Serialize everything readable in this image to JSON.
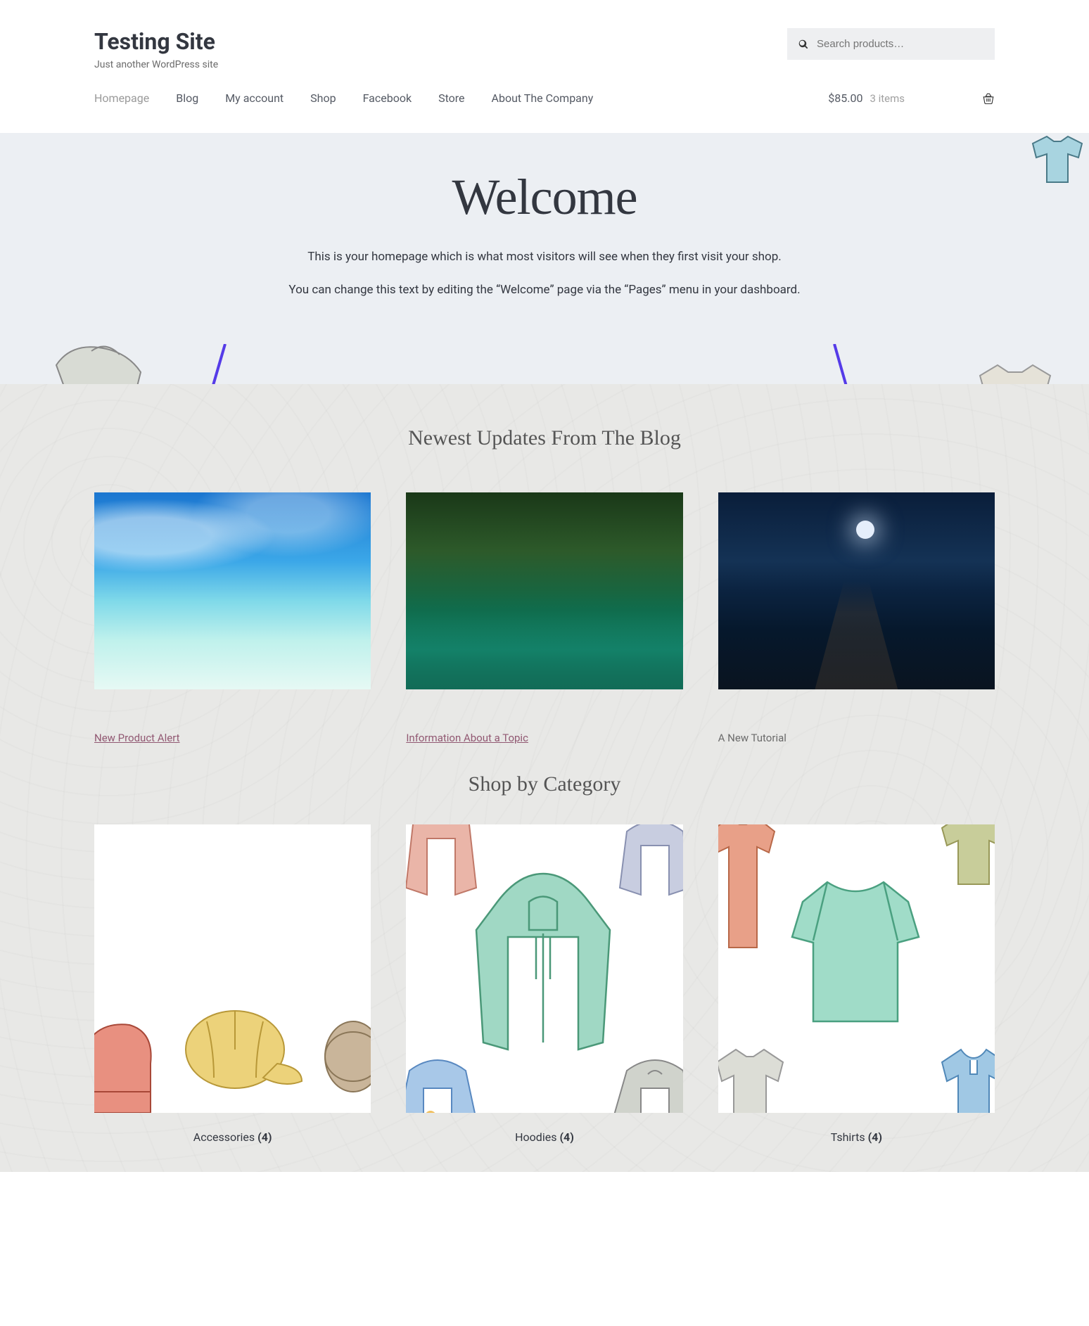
{
  "header": {
    "title": "Testing Site",
    "tagline": "Just another WordPress site",
    "search_placeholder": "Search products…"
  },
  "nav": {
    "items": [
      {
        "label": "Homepage",
        "active": true
      },
      {
        "label": "Blog",
        "active": false
      },
      {
        "label": "My account",
        "active": false
      },
      {
        "label": "Shop",
        "active": false
      },
      {
        "label": "Facebook",
        "active": false
      },
      {
        "label": "Store",
        "active": false
      },
      {
        "label": "About The Company",
        "active": false
      }
    ],
    "cart": {
      "total": "$85.00",
      "items_label": "3 items"
    }
  },
  "hero": {
    "title": "Welcome",
    "line1": "This is your homepage which is what most visitors will see when they first visit your shop.",
    "line2": "You can change this text by editing the “Welcome” page via the “Pages” menu in your dashboard."
  },
  "blog": {
    "heading": "Newest Updates From The Blog",
    "posts": [
      {
        "title": "New Product Alert",
        "linked": true
      },
      {
        "title": "Information About a Topic",
        "linked": true
      },
      {
        "title": "A New Tutorial",
        "linked": false
      }
    ]
  },
  "shop": {
    "heading": "Shop by Category",
    "categories": [
      {
        "name": "Accessories",
        "count": "(4)"
      },
      {
        "name": "Hoodies",
        "count": "(4)"
      },
      {
        "name": "Tshirts",
        "count": "(4)"
      }
    ]
  },
  "colors": {
    "arrow": "#553be8"
  }
}
